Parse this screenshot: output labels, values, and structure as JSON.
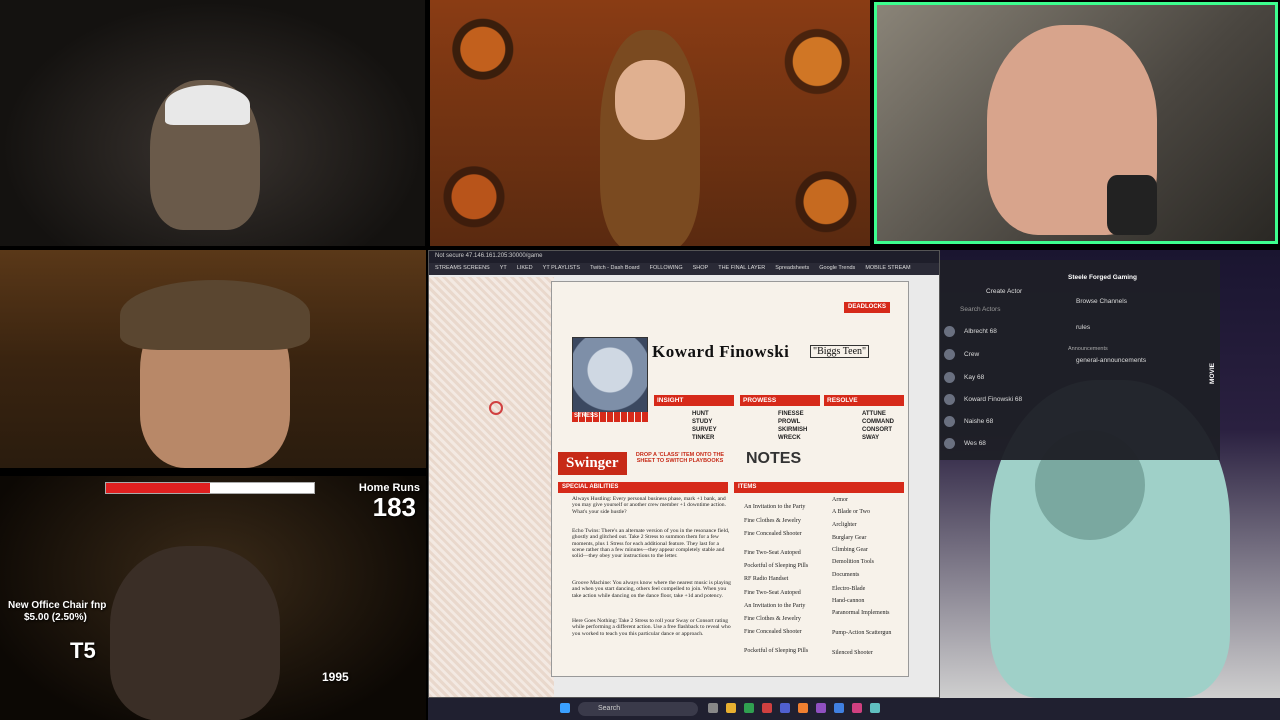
{
  "browser": {
    "url": "Not secure  47.146.161.205:30000/game",
    "bookmarks": [
      "STREAMS SCREENS",
      "YT",
      "LIKED",
      "YT PLAYLISTS",
      "Twitch - Dash Board",
      "FOLLOWING",
      "SHOP",
      "THE FINAL LAYER",
      "Spreadsheets",
      "Google Trends",
      "MOBILE STREAM"
    ]
  },
  "overlay": {
    "home_runs_label": "Home Runs",
    "home_runs_value": "183",
    "office_chair_line1": "New Office Chair fnp",
    "office_chair_line2": "$5.00 (2.50%)",
    "t5": "T5",
    "year": "1995"
  },
  "sheet": {
    "character_name": "Koward Finowski",
    "alias": "\"Biggs Teen\"",
    "playbook": "Swinger",
    "notes_title": "NOTES",
    "stress_label": "STRESS",
    "deadlocks_label": "DEADLOCKS",
    "special_abilities_label": "SPECIAL ABILITIES",
    "items_label": "ITEMS",
    "drop_class_text": "DROP A 'CLASS' ITEM ONTO THE SHEET TO SWITCH PLAYBOOKS",
    "insight": {
      "label": "INSIGHT",
      "actions": [
        "HUNT",
        "STUDY",
        "SURVEY",
        "TINKER"
      ]
    },
    "prowess": {
      "label": "PROWESS",
      "actions": [
        "FINESSE",
        "PROWL",
        "SKIRMISH",
        "WRECK"
      ]
    },
    "resolve": {
      "label": "RESOLVE",
      "actions": [
        "ATTUNE",
        "COMMAND",
        "CONSORT",
        "SWAY"
      ]
    },
    "abilities": [
      "Always Hustling: Every personal business phase, mark +1 bank, and you may give yourself or another crew member +1 downtime action. What's your side hustle?",
      "Echo Twins: There's an alternate version of you in the resonance field, ghostly and glitched out. Take 2 Stress to summon them for a few moments, plus 1 Stress for each additional feature. They last for a scene rather than a few minutes—they appear completely stable and solid—they obey your instructions to the letter.",
      "Groove Machine: You always know where the nearest music is playing and when you start dancing, others feel compelled to join. When you take action while dancing on the dance floor, take +1d and potency.",
      "Here Goes Nothing: Take 2 Stress to roll your Sway or Consort rating while performing a different action. Use a free flashback to reveal who you worked to teach you this particular dance or approach."
    ],
    "items_left": [
      "An Invitation to the Party",
      "Fine Clothes & Jewelry",
      "Fine Concealed Shooter",
      "Fine Two-Seat Autoped",
      "Pocketful of Sleeping Pills",
      "RF Radio Handset",
      "Fine Two-Seat Autoped",
      "An Invitation to the Party",
      "Fine Clothes & Jewelry",
      "Fine Concealed Shooter",
      "Pocketful of Sleeping Pills"
    ],
    "items_right": [
      "Armor",
      "A Blade or Two",
      "Arclighter",
      "Burglary Gear",
      "Climbing Gear",
      "Demolition Tools",
      "Documents",
      "Electro-Blade",
      "Hand-cannon",
      "Paranormal Implements",
      "Pump-Action Scattergun",
      "Silenced Shooter"
    ]
  },
  "discord": {
    "server_name": "Steele Forged Gaming",
    "browse_channels": "Browse Channels",
    "rules": "rules",
    "announcements": "Announcements",
    "general_announcements": "general-announcements",
    "create_actor": "Create Actor",
    "search_actors": "Search Actors",
    "actors": [
      "Albrecht 68",
      "Crew",
      "Kay 68",
      "Koward Finowski 68",
      "Naishe 68",
      "Wes 68"
    ],
    "movie_label": "MOVIE"
  },
  "taskbar": {
    "search_placeholder": "Search"
  },
  "colors": {
    "highlight_border": "#3dff8f",
    "sheet_red": "#d62a1a"
  }
}
